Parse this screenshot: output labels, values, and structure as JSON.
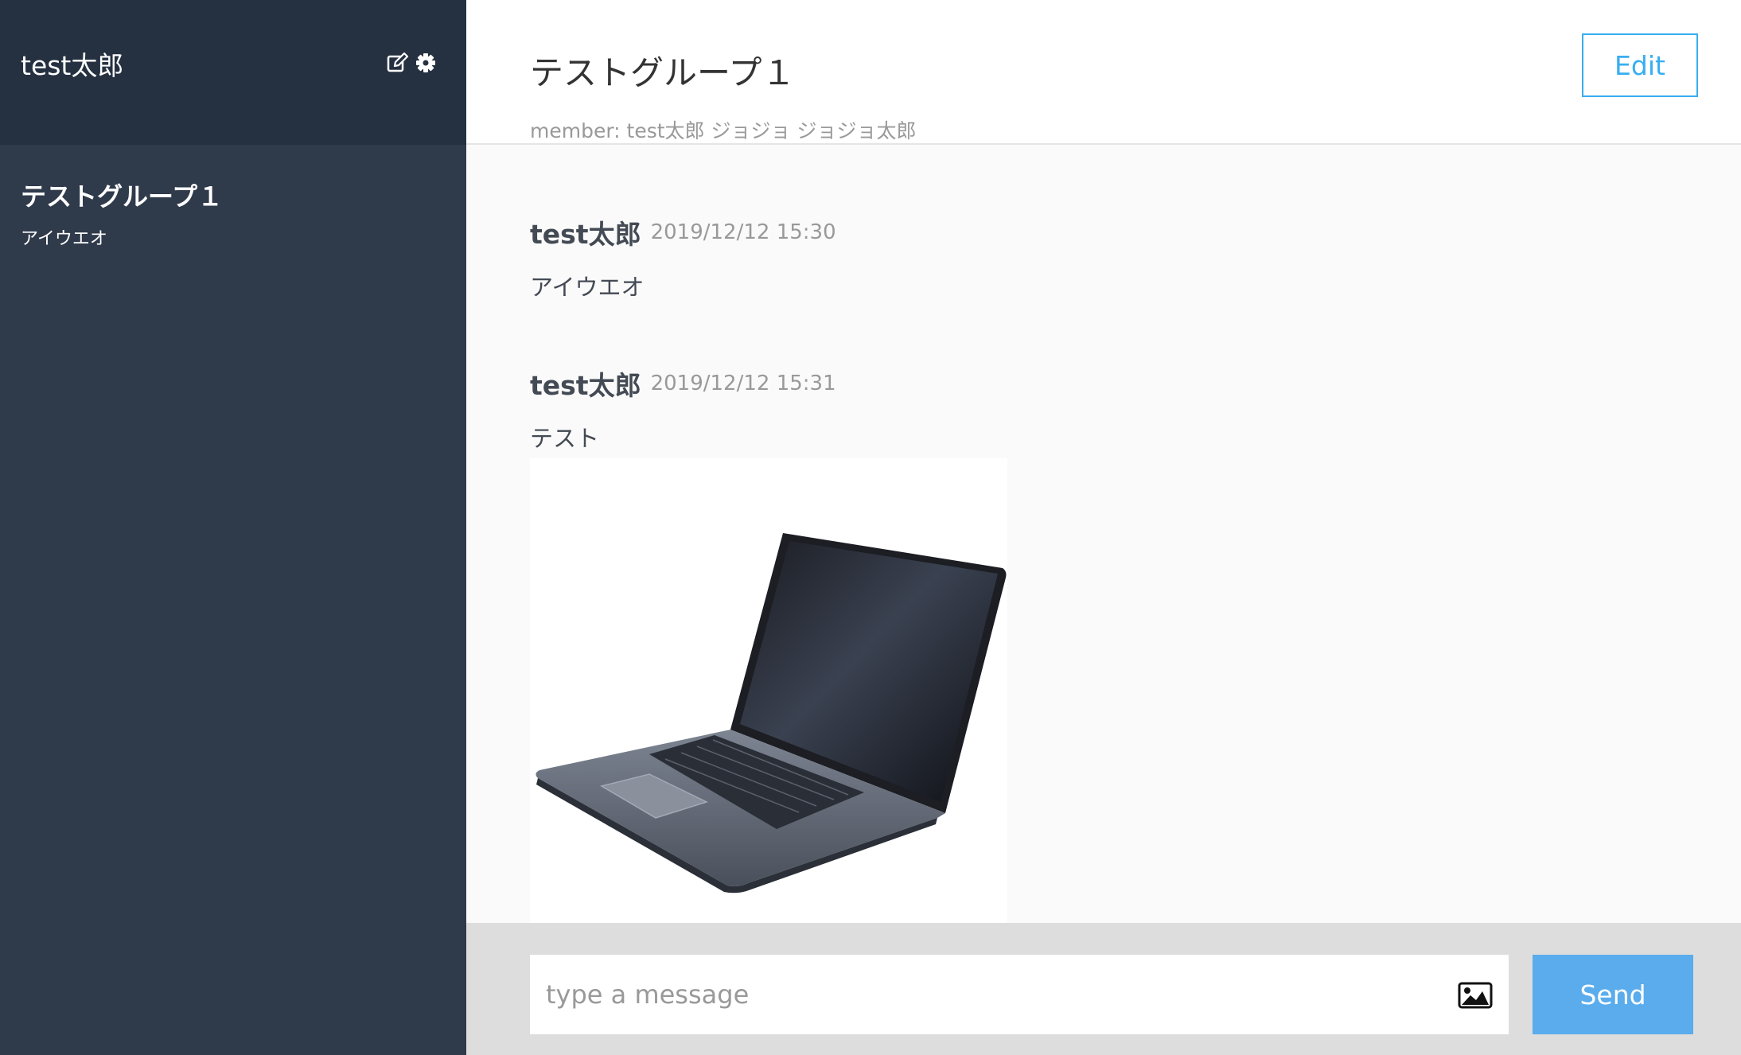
{
  "sidebar": {
    "user_name": "test太郎",
    "groups": [
      {
        "name": "テストグループ１",
        "last_message": "アイウエオ"
      }
    ]
  },
  "header": {
    "group_name": "テストグループ１",
    "members": "member: test太郎 ジョジョ ジョジョ太郎",
    "edit_label": "Edit"
  },
  "messages": [
    {
      "user": "test太郎",
      "date": "2019/12/12 15:30",
      "text": "アイウエオ"
    },
    {
      "user": "test太郎",
      "date": "2019/12/12 15:31",
      "text": "テスト",
      "image": "laptop"
    }
  ],
  "form": {
    "placeholder": "type a message",
    "send_label": "Send"
  },
  "colors": {
    "sidebar_bg": "#2f3a4b",
    "sidebar_header_bg": "#253141",
    "accent": "#38aef0",
    "send_bg": "#5aacec"
  }
}
